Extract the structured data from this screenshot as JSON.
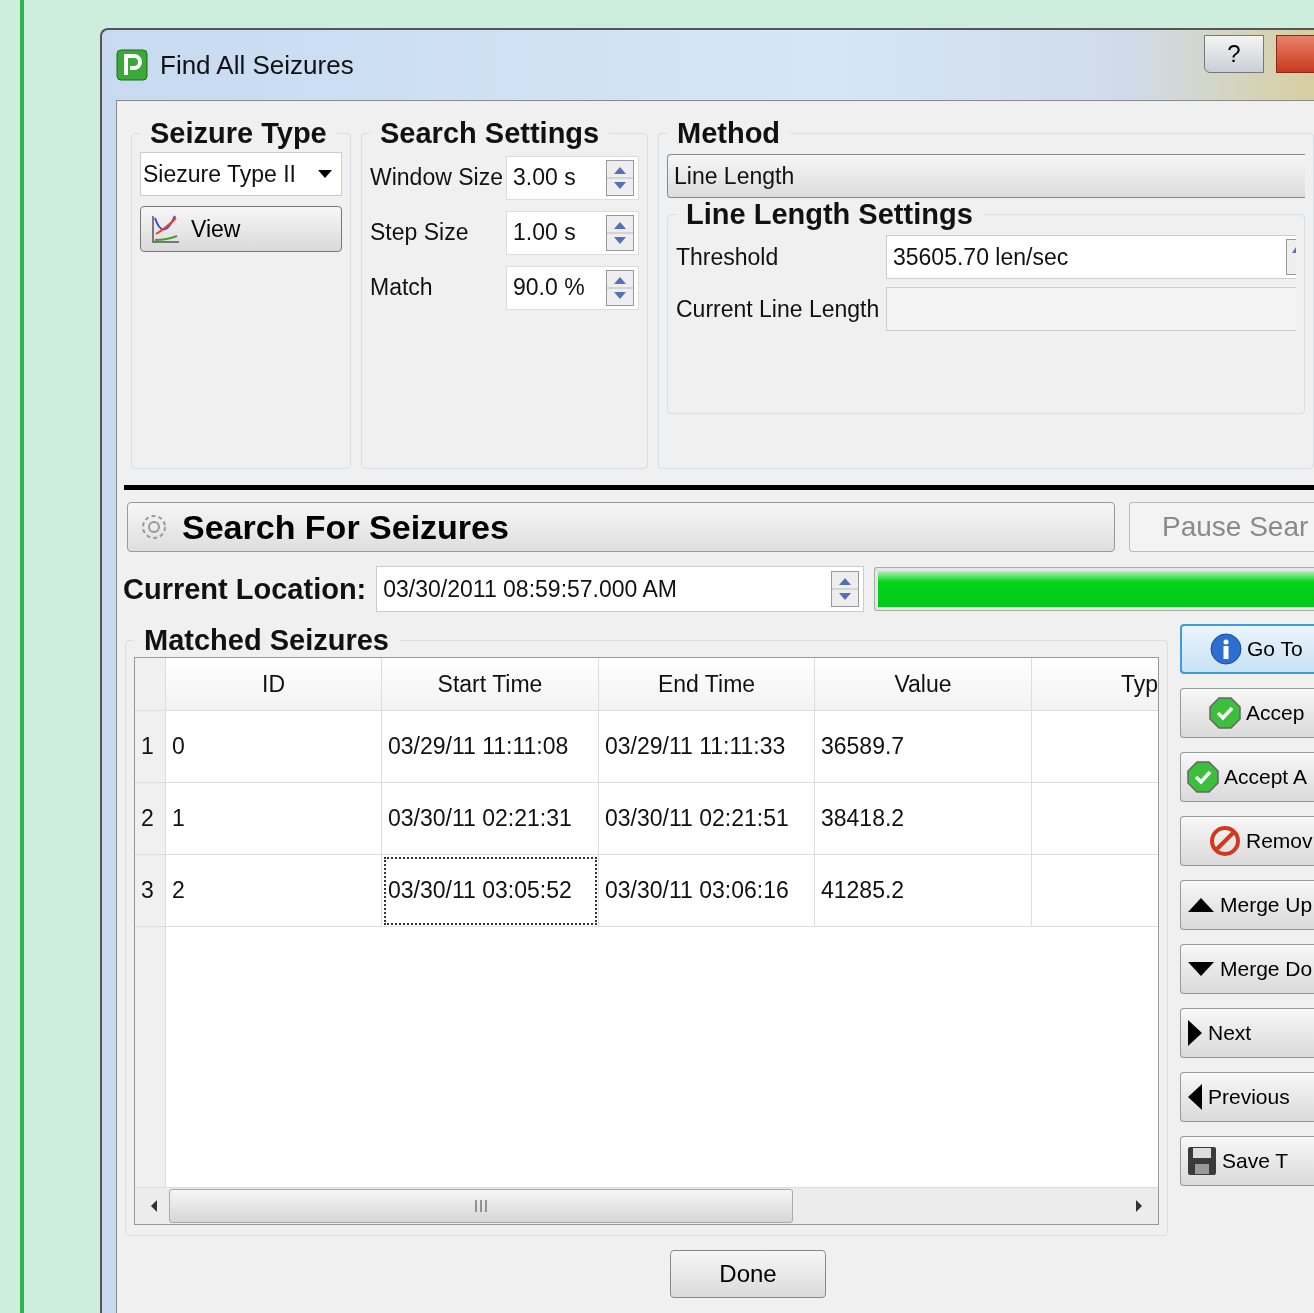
{
  "window": {
    "title": "Find All Seizures",
    "help_button": "?"
  },
  "seizure_type": {
    "title": "Seizure Type",
    "selection": "Siezure Type II",
    "view_button": "View"
  },
  "search_settings": {
    "title": "Search Settings",
    "fields": [
      {
        "label": "Window Size",
        "value": "3.00 s"
      },
      {
        "label": "Step Size",
        "value": "1.00 s"
      },
      {
        "label": "Match",
        "value": "90.0 %"
      }
    ]
  },
  "method": {
    "title": "Method",
    "selection": "Line Length",
    "settings": {
      "title": "Line Length Settings",
      "threshold_label": "Threshold",
      "threshold_value": "35605.70 len/sec",
      "current_label": "Current Line Length"
    }
  },
  "search_button": "Search For Seizures",
  "pause_button": {
    "label": "Pause Sear",
    "disabled": true
  },
  "current_location": {
    "label": "Current Location:",
    "value": "03/30/2011 08:59:57.000 AM"
  },
  "progress": {
    "level": 1
  },
  "matched": {
    "title": "Matched Seizures",
    "columns": [
      "ID",
      "Start Time",
      "End Time",
      "Value",
      "Typ"
    ],
    "rows": [
      {
        "number": "1",
        "cells": [
          {
            "text": "0",
            "focused": false
          },
          {
            "text": "03/29/11 11:11:08",
            "focused": false
          },
          {
            "text": "03/29/11 11:11:33",
            "focused": false
          },
          {
            "text": "36589.7",
            "focused": false
          }
        ]
      },
      {
        "number": "2",
        "cells": [
          {
            "text": "1",
            "focused": false
          },
          {
            "text": "03/30/11 02:21:31",
            "focused": false
          },
          {
            "text": "03/30/11 02:21:51",
            "focused": false
          },
          {
            "text": "38418.2",
            "focused": false
          }
        ]
      },
      {
        "number": "3",
        "cells": [
          {
            "text": "2",
            "focused": false
          },
          {
            "text": "03/30/11 03:05:52",
            "focused": true
          },
          {
            "text": "03/30/11 03:06:16",
            "focused": false
          },
          {
            "text": "41285.2",
            "focused": false
          }
        ]
      }
    ]
  },
  "actions": [
    {
      "label": "Go To",
      "kind": "info",
      "default": true
    },
    {
      "label": "Accep",
      "kind": "check",
      "default": false
    },
    {
      "label": "Accept A",
      "kind": "check",
      "default": false
    },
    {
      "label": "Remov",
      "kind": "stop",
      "default": false
    },
    {
      "label": "Merge Up",
      "kind": "up",
      "default": false
    },
    {
      "label": "Merge Do",
      "kind": "down",
      "default": false
    },
    {
      "label": "Next",
      "kind": "right",
      "default": false
    },
    {
      "label": "Previous",
      "kind": "left",
      "default": false
    },
    {
      "label": "Save T",
      "kind": "save",
      "default": false
    }
  ],
  "done_button": "Done"
}
